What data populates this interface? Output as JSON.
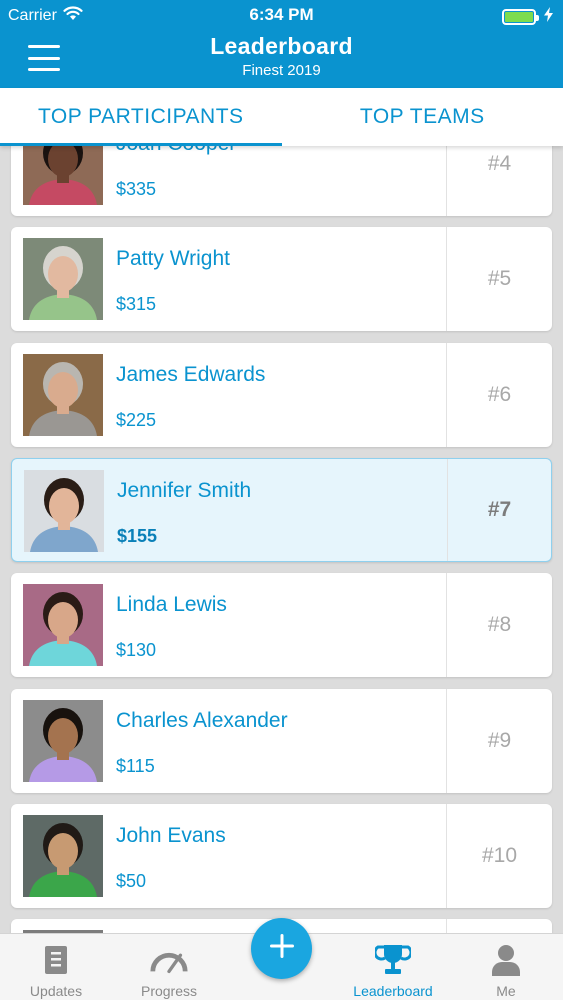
{
  "status_bar": {
    "carrier": "Carrier",
    "time": "6:34 PM"
  },
  "header": {
    "title": "Leaderboard",
    "subtitle": "Finest 2019"
  },
  "tabs": [
    {
      "label": "TOP PARTICIPANTS",
      "active": true
    },
    {
      "label": "TOP TEAMS",
      "active": false
    }
  ],
  "leaderboard": [
    {
      "name": "Joan Cooper",
      "amount": "$335",
      "rank": "#4",
      "highlight": false,
      "avatar": {
        "bg": "#8e6a56",
        "skin": "#6b4230",
        "hair": "#1a1210",
        "shirt": "#c54a63"
      }
    },
    {
      "name": "Patty Wright",
      "amount": "$315",
      "rank": "#5",
      "highlight": false,
      "avatar": {
        "bg": "#7d8a78",
        "skin": "#e2b9a0",
        "hair": "#d6d4ce",
        "shirt": "#96c48a"
      }
    },
    {
      "name": "James Edwards",
      "amount": "$225",
      "rank": "#6",
      "highlight": false,
      "avatar": {
        "bg": "#8a6a48",
        "skin": "#d9ab8e",
        "hair": "#b9b6b0",
        "shirt": "#9a9793"
      }
    },
    {
      "name": "Jennifer Smith",
      "amount": "$155",
      "rank": "#7",
      "highlight": true,
      "avatar": {
        "bg": "#d9dde1",
        "skin": "#e2b599",
        "hair": "#2a1d16",
        "shirt": "#7fa6cc"
      }
    },
    {
      "name": "Linda Lewis",
      "amount": "$130",
      "rank": "#8",
      "highlight": false,
      "avatar": {
        "bg": "#a86a86",
        "skin": "#d8a789",
        "hair": "#2a1b16",
        "shirt": "#6ed6da"
      }
    },
    {
      "name": "Charles Alexander",
      "amount": "$115",
      "rank": "#9",
      "highlight": false,
      "avatar": {
        "bg": "#8c8c8c",
        "skin": "#a4734f",
        "hair": "#18120e",
        "shirt": "#b59ae6"
      }
    },
    {
      "name": "John Evans",
      "amount": "$50",
      "rank": "#10",
      "highlight": false,
      "avatar": {
        "bg": "#5e6a66",
        "skin": "#c79a72",
        "hair": "#201a16",
        "shirt": "#3ba64a"
      }
    },
    {
      "name": "",
      "amount": "",
      "rank": "",
      "highlight": false,
      "avatar": {
        "bg": "#7c7c7c",
        "skin": "#c9a184",
        "hair": "#2a2018",
        "shirt": "#777777"
      }
    }
  ],
  "bottom_nav": [
    {
      "label": "Updates",
      "icon": "updates-icon",
      "active": false
    },
    {
      "label": "Progress",
      "icon": "gauge-icon",
      "active": false
    },
    {
      "label": "Leaderboard",
      "icon": "trophy-icon",
      "active": true
    },
    {
      "label": "Me",
      "icon": "person-icon",
      "active": false
    }
  ],
  "fab": {
    "icon": "plus-icon"
  },
  "colors": {
    "brand": "#0a93cf",
    "highlight_bg": "#e6f5fc",
    "inactive_gray": "#8a8a8a",
    "battery_green": "#7ddc4e"
  }
}
